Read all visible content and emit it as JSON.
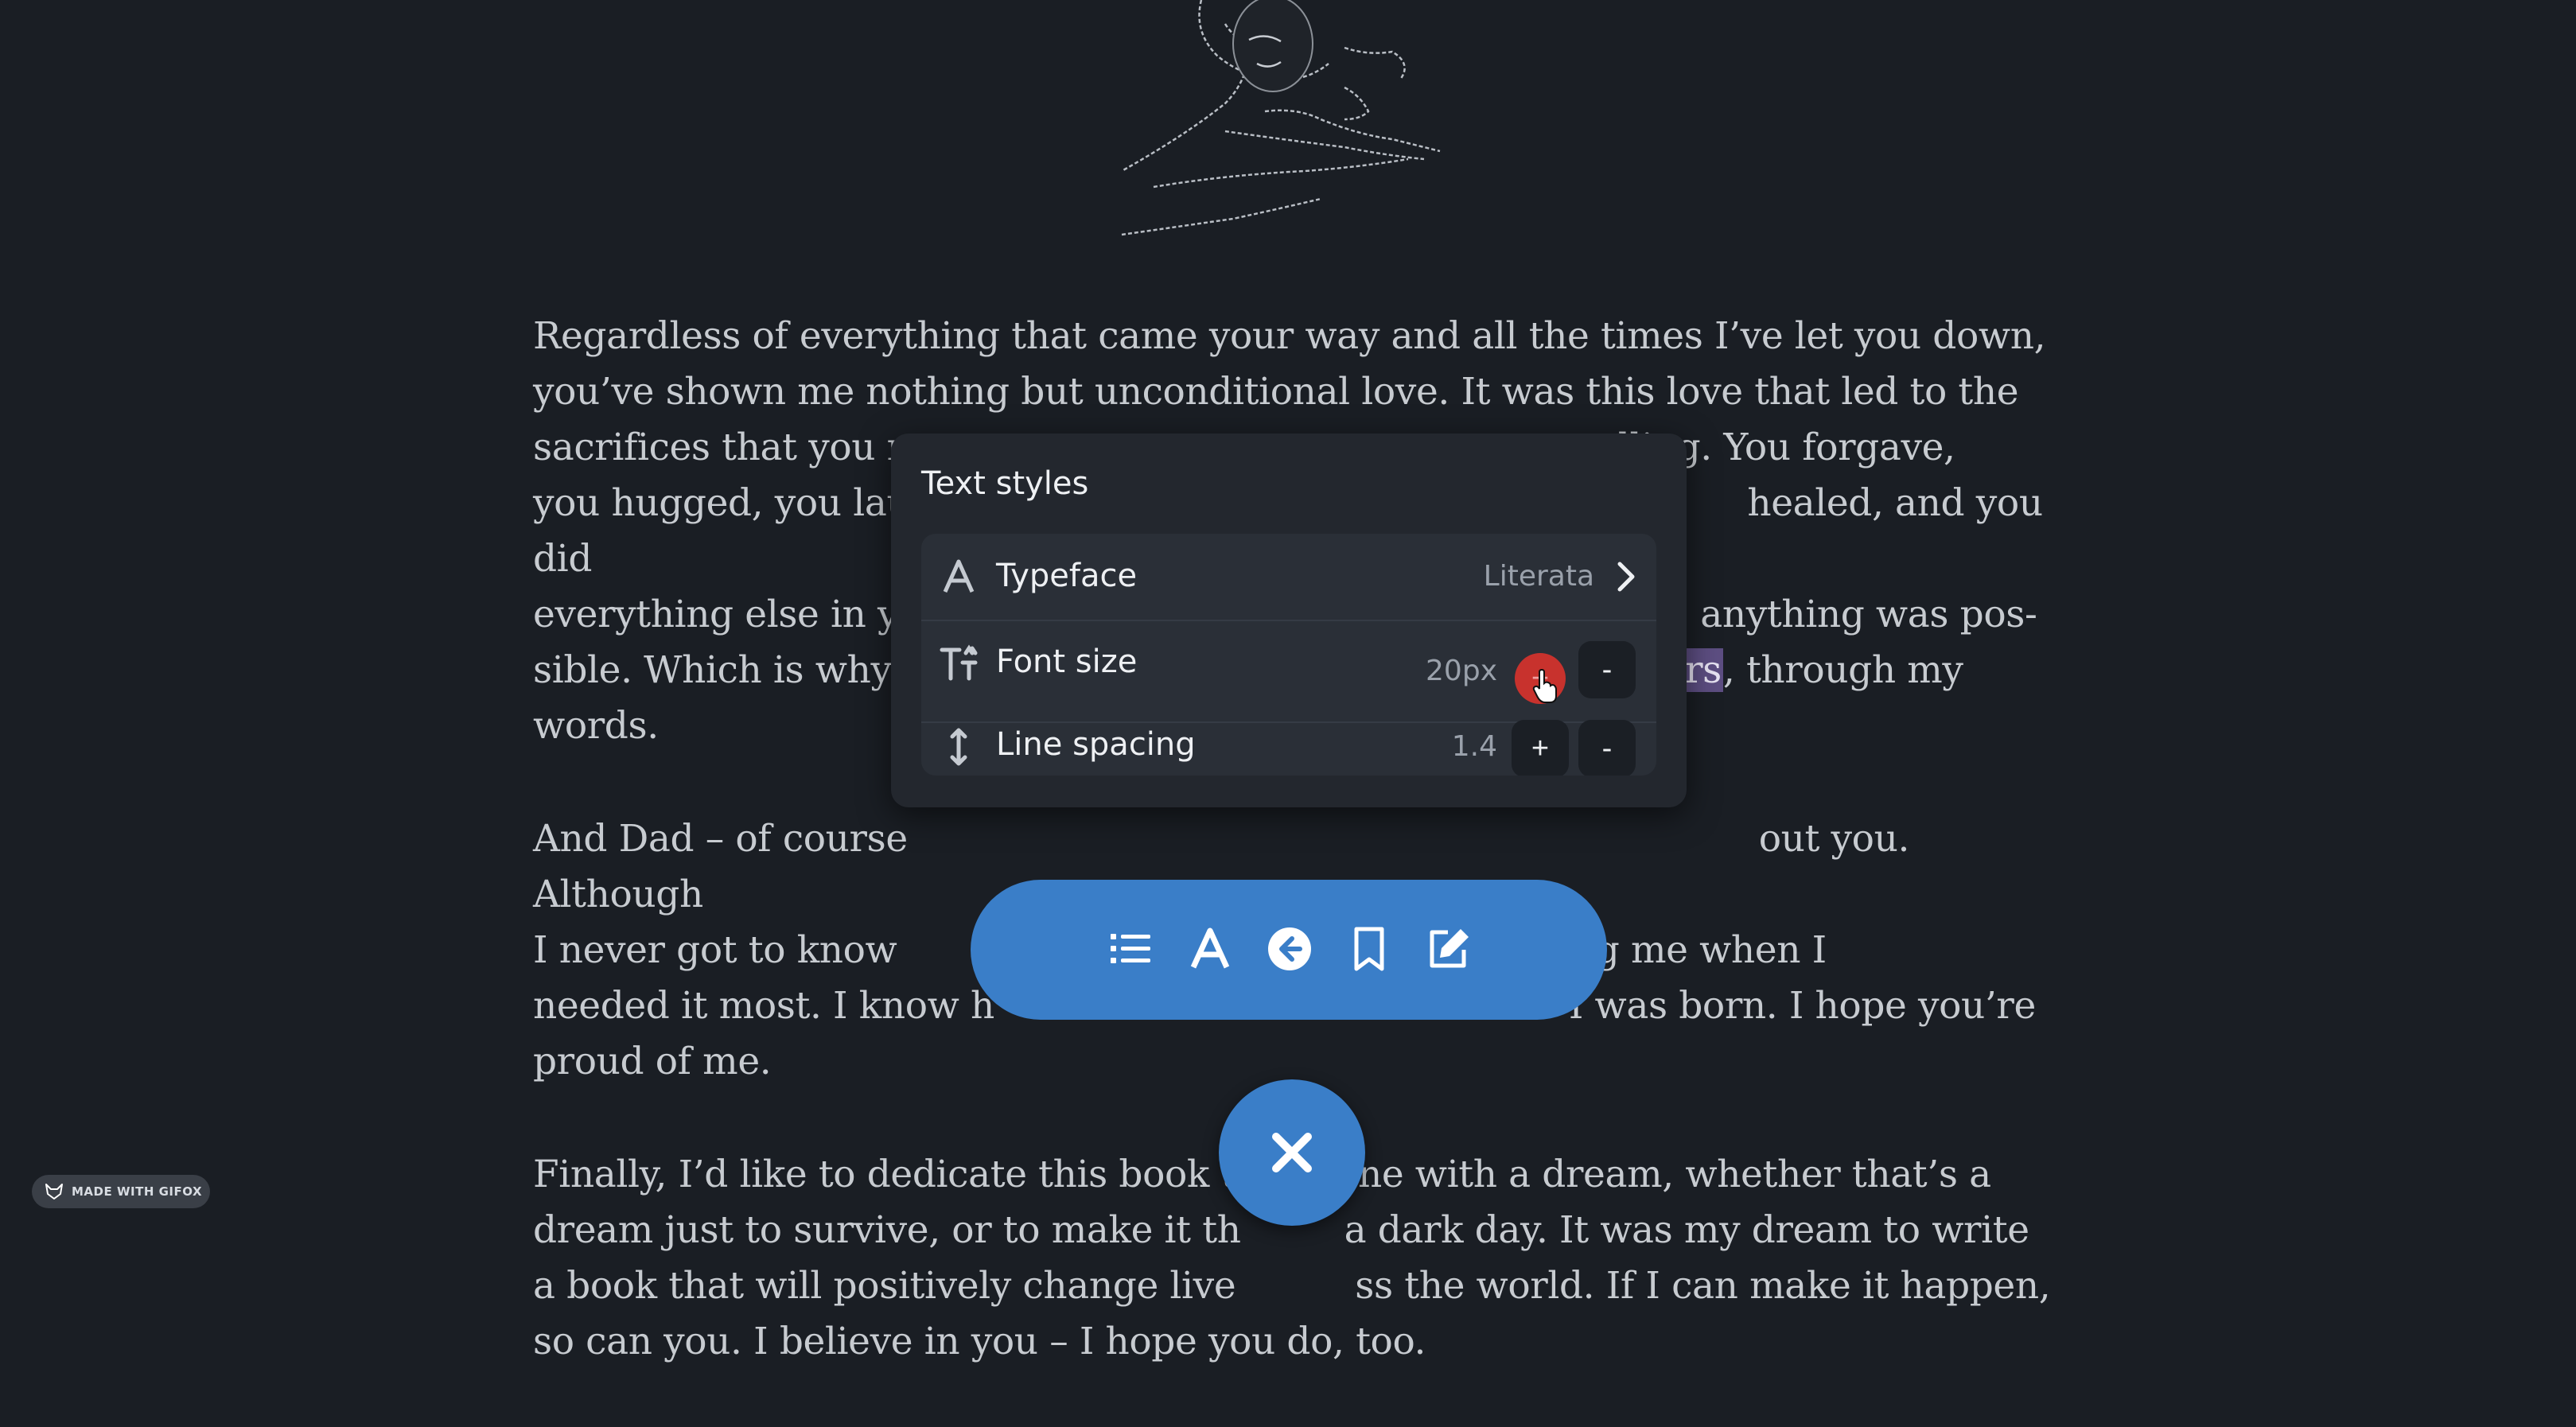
{
  "reader": {
    "p1_before": "Regardless of everything that came your way and all the times I’ve let you down, you’ve shown me nothing but unconditional love. It was this love that led to the sacrifices that you made ",
    "p1_hidden": "",
    "p1_line1": "Regardless of everything that came your way and all the times I’ve let you down,",
    "p1_line2": "you’ve shown me nothing but unconditional love. It was this love that led to the",
    "p1_line3": "sacrifices that you m",
    "p1_line3_end": "lling. You forgave,",
    "p1_line4": "you hugged, you lau",
    "p1_line4_end": "healed, and you did",
    "p1_line5": "everything else in y",
    "p1_line5_end": "anything was pos-",
    "p1_line6": "sible. Which is why",
    "p1_highlight": "ers",
    "p1_line6_end": ", through my",
    "p1_line7": "words.",
    "p2_line1": "And Dad – of course",
    "p2_line1_end": "out you. Although",
    "p2_line2": "I never got to know",
    "p2_line2_end": "guiding me when I",
    "p2_line3": "needed it most. I know h",
    "p2_line3_end": "I was born. I hope you’re",
    "p2_line4": "proud of me.",
    "p3_line1": "Finally, I’d like to dedicate this book to anyone with a dream, whether that’s a",
    "p3_line2": "dream just to survive, or to make it th",
    "p3_line2_end": "a dark day. It was my dream to write",
    "p3_line3": "a book that will positively change live",
    "p3_line3_end": "ss the world. If I can make it happen,",
    "p3_line4": "so can you. I believe in you – I hope you do, too."
  },
  "text_styles": {
    "title": "Text styles",
    "typeface": {
      "label": "Typeface",
      "value": "Literata",
      "icon": "typeface-icon"
    },
    "font_size": {
      "label": "Font size",
      "value": "20px",
      "increase": "+",
      "decrease": "-",
      "icon": "font-size-icon"
    },
    "line_spacing": {
      "label": "Line spacing",
      "value": "1.4",
      "increase": "+",
      "decrease": "-",
      "icon": "line-spacing-icon"
    }
  },
  "toolbar": {
    "icons": [
      "list-icon",
      "text-style-icon",
      "back-icon",
      "bookmark-icon",
      "edit-icon"
    ]
  },
  "badge": {
    "text": "MADE WITH GIFOX"
  },
  "colors": {
    "accent": "#3a7ec8",
    "highlight": "#5d4e82",
    "background": "#1a1e24",
    "panel": "#23272e",
    "active_press": "#c8322d"
  }
}
